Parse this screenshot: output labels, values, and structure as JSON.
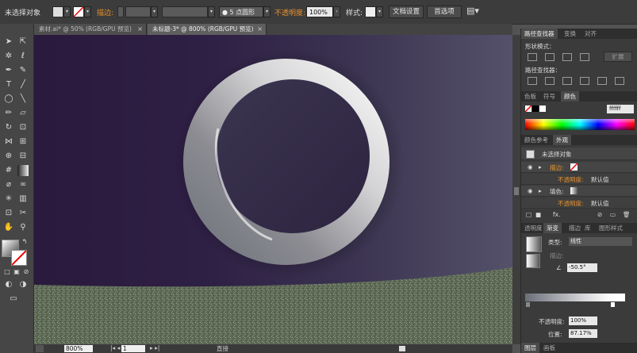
{
  "control_bar": {
    "selection_status": "未选择对象",
    "stroke_label": "描边:",
    "brush_label": "5 点圆形",
    "opacity_label": "不透明度:",
    "opacity_value": "100%",
    "style_label": "样式:",
    "doc_setup_button": "文档设置",
    "prefs_button": "首选项"
  },
  "tabs": [
    {
      "label": "素材.ai* @ 50% (RGB/GPU 预览)",
      "close": "×"
    },
    {
      "label": "未标题-3* @ 800% (RGB/GPU 预览)",
      "close": "×"
    }
  ],
  "status_bar": {
    "zoom": "800%",
    "page": "1",
    "mode": "直接"
  },
  "pathfinder_panel": {
    "tabs": [
      "路径查找器",
      "变换",
      "对齐"
    ],
    "shape_modes_label": "形状模式：",
    "expand_button": "扩展",
    "pathfinders_label": "路径查找器："
  },
  "color_panel": {
    "tabs": [
      "色板",
      "符号",
      "颜色"
    ],
    "hex_value": "ffffff"
  },
  "appearance_panel": {
    "tabs": [
      "颜色参考",
      "外观"
    ],
    "object_label": "未选择对象",
    "stroke_label": "描边:",
    "opacity_label": "不透明度:",
    "opacity_value": "默认值",
    "fill_label": "填色:",
    "fill_opacity_label": "不透明度:",
    "fill_opacity_value": "默认值",
    "fx_label": "fx."
  },
  "gradient_panel": {
    "tabs": [
      "透明度",
      "渐变",
      "描边",
      "库",
      "图形样式"
    ],
    "type_label": "类型:",
    "type_value": "线性",
    "stroke_label": "描边:",
    "angle_value": "-50.5°",
    "opacity_label": "不透明度:",
    "opacity_value": "100%",
    "position_label": "位置:",
    "position_value": "87.17%"
  },
  "bottom_tabs": [
    "图层",
    "画板"
  ],
  "colors": {
    "accent_orange": "#e8912e",
    "canvas_left": "#2a1a3d",
    "canvas_right": "#55516a",
    "ground": "#5e6a55"
  }
}
